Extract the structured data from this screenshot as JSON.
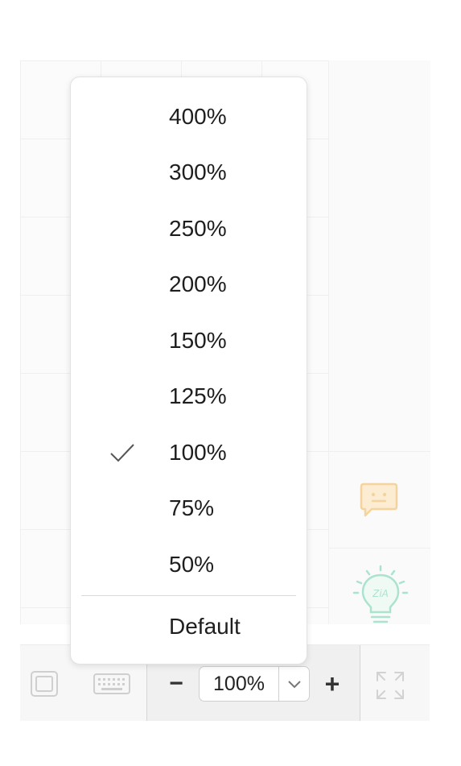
{
  "zoom_menu": {
    "options": [
      {
        "label": "400%",
        "selected": false
      },
      {
        "label": "300%",
        "selected": false
      },
      {
        "label": "250%",
        "selected": false
      },
      {
        "label": "200%",
        "selected": false
      },
      {
        "label": "150%",
        "selected": false
      },
      {
        "label": "125%",
        "selected": false
      },
      {
        "label": "100%",
        "selected": true
      },
      {
        "label": "75%",
        "selected": false
      },
      {
        "label": "50%",
        "selected": false
      }
    ],
    "default_label": "Default"
  },
  "toolbar": {
    "zoom_out_symbol": "−",
    "zoom_value": "100%",
    "zoom_in_symbol": "+"
  },
  "icons": {
    "fit": "fit-to-screen-icon",
    "keyboard": "keyboard-icon",
    "caret": "chevron-down-icon",
    "fullscreen": "fullscreen-icon",
    "chat": "chat-icon",
    "bulb": "lightbulb-icon",
    "check": "checkmark-icon"
  },
  "colors": {
    "chat_icon": "#f3c780",
    "bulb_icon": "#9fe0c8",
    "menu_bg": "#ffffff",
    "toolbar_bg": "#f7f7f7"
  }
}
